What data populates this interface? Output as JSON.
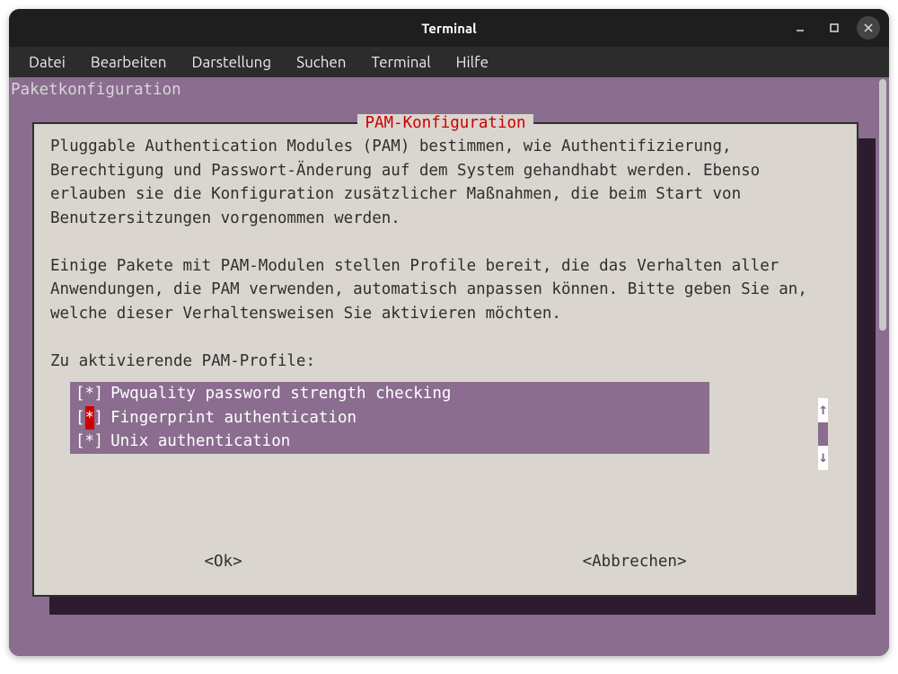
{
  "window": {
    "title": "Terminal"
  },
  "menubar": {
    "items": [
      "Datei",
      "Bearbeiten",
      "Darstellung",
      "Suchen",
      "Terminal",
      "Hilfe"
    ]
  },
  "packageconfig": {
    "header": "Paketkonfiguration"
  },
  "dialog": {
    "title": "PAM-Konfiguration",
    "para1": "Pluggable Authentication Modules (PAM) bestimmen, wie Authentifizierung, Berechtigung und Passwort-Änderung auf dem System gehandhabt werden. Ebenso erlauben sie die Konfiguration zusätzlicher Maßnahmen, die beim Start von Benutzersitzungen vorgenommen werden.",
    "para2": "Einige Pakete mit PAM-Modulen stellen Profile bereit, die das Verhalten aller Anwendungen, die PAM verwenden, automatisch anpassen können. Bitte geben Sie an, welche dieser Verhaltensweisen Sie aktivieren möchten.",
    "prompt": "Zu aktivierende PAM-Profile:",
    "profiles": [
      {
        "checked": true,
        "selected": false,
        "label": "Pwquality password strength checking"
      },
      {
        "checked": true,
        "selected": true,
        "label": "Fingerprint authentication"
      },
      {
        "checked": true,
        "selected": false,
        "label": "Unix authentication"
      }
    ],
    "buttons": {
      "ok": "<Ok>",
      "cancel": "<Abbrechen>"
    }
  }
}
